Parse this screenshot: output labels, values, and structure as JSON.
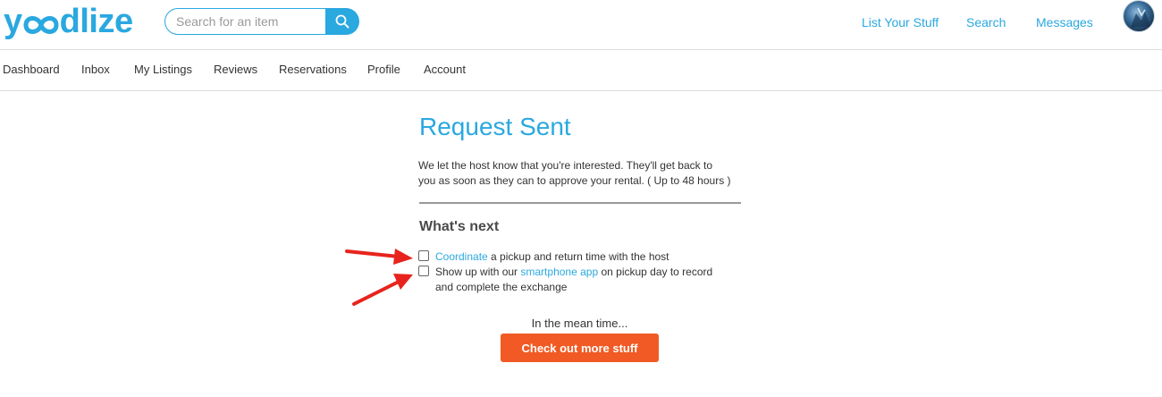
{
  "brand": {
    "logo_text_start": "y",
    "logo_text_end": "dlize",
    "accent": "#2aa8e0",
    "cta_color": "#f15a24"
  },
  "header": {
    "search": {
      "placeholder": "Search for an item",
      "icon": "search-icon"
    },
    "links": [
      "List Your Stuff",
      "Search",
      "Messages"
    ]
  },
  "subnav": [
    "Dashboard",
    "Inbox",
    "My Listings",
    "Reviews",
    "Reservations",
    "Profile",
    "Account"
  ],
  "main": {
    "title": "Request Sent",
    "intro_line1": "We let the host know that you're interested. They'll get back to",
    "intro_line2": "you as soon as they can to approve your rental. ( Up to 48 hours )",
    "whats_next": "What's next",
    "step1": {
      "link": "Coordinate",
      "text": " a pickup and return time with the host",
      "checked": false
    },
    "step2": {
      "prefix": "Show up with our ",
      "link": "smartphone app",
      "suffix": " on pickup day to record",
      "line2": "and complete the exchange",
      "checked": false
    },
    "meantime": "In the mean time...",
    "cta_label": "Check out more stuff"
  }
}
